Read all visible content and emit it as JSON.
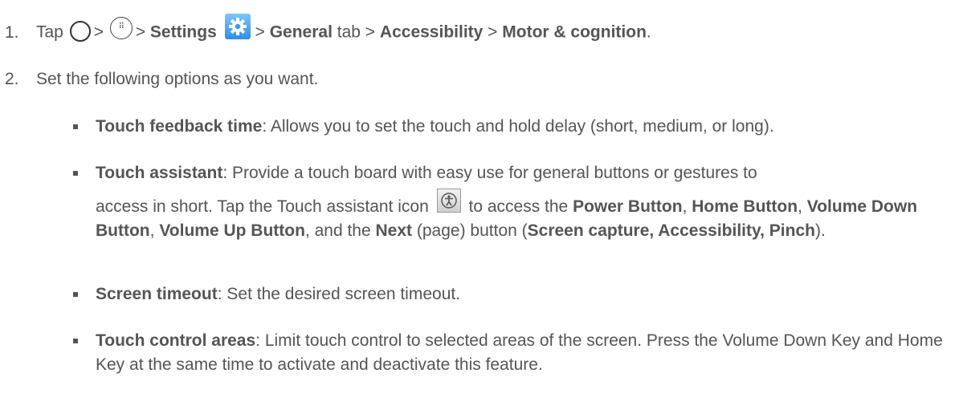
{
  "steps": [
    {
      "number": "1.",
      "parts": {
        "tap": "Tap",
        "sep1": ">",
        "sep2": ">",
        "settings": "Settings",
        "sep3": ">",
        "general": "General",
        "tab": "tab >",
        "accessibility": "Accessibility",
        "sep4": ">",
        "motor": "Motor & cognition",
        "end": "."
      }
    },
    {
      "number": "2.",
      "text": "Set the following options as you want."
    }
  ],
  "options": [
    {
      "title": "Touch feedback time",
      "desc": ": Allows you to set the touch and hold delay (short, medium, or long)."
    },
    {
      "title": "Touch assistant",
      "desc1": ": Provide a touch board with easy use for general buttons or gestures to",
      "desc2": "access in short. Tap the Touch assistant icon",
      "desc3": "to access the",
      "power": "Power Button",
      "c1": ",",
      "home": "Home Button",
      "c2": ",",
      "vol_down": "Volume Down Button",
      "c3": ",",
      "vol_up": "Volume Up Button",
      "c4": ", and the",
      "next": "Next",
      "c5": "(page) button (",
      "extras": "Screen capture, Accessibility, Pinch",
      "c6": ")."
    },
    {
      "title": "Screen timeout",
      "desc": ": Set the desired screen timeout."
    },
    {
      "title": "Touch control areas",
      "desc": ": Limit touch control to selected areas of the screen. Press the Volume Down Key and Home Key at the same time to activate and deactivate this feature."
    }
  ],
  "icons": {
    "home": "home-circle-icon",
    "apps": "apps-icon",
    "settings": "settings-gear-icon",
    "touch_assistant": "touch-assistant-icon"
  },
  "colors": {
    "text": "#555555",
    "settings_icon": "#2d8ee8"
  }
}
